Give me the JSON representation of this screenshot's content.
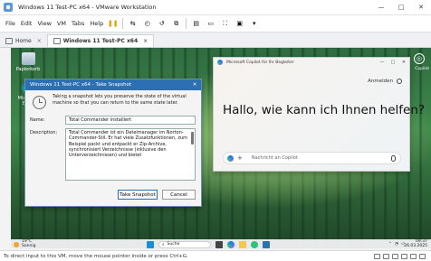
{
  "window": {
    "title": "Windows 11 Test-PC x64 - VMware Workstation",
    "controls": [
      "—",
      "□",
      "✕"
    ]
  },
  "menu": [
    "File",
    "Edit",
    "View",
    "VM",
    "Tabs",
    "Help"
  ],
  "tabs": [
    {
      "label": "Home"
    },
    {
      "label": "Windows 11 Test-PC x64"
    }
  ],
  "desktop": {
    "icons": [
      "Papierkorb",
      "Microsoft Edge"
    ],
    "copilot_label": "Copilot"
  },
  "snapshot_dialog": {
    "title": "Windows 11 Test-PC x64 - Take Snapshot",
    "info": "Taking a snapshot lets you preserve the state of the virtual machine so that you can return to the same state later.",
    "name_label": "Name:",
    "name_value": "Total Commander installiert",
    "description_label": "Description:",
    "description_value": "Total Commander ist ein Dateimanager im Norton-Commander-Stil. Er hat viele Zusatzfunktionen, zum Beispiel packt und entpackt er Zip-Archive, synchronisiert Verzeichnisse (inklusive den Unterverzeichnissen) und bietet",
    "take_button": "Take Snapshot",
    "cancel_button": "Cancel"
  },
  "copilot": {
    "window_title": "Microsoft Copilot für Ihr Begleiter",
    "controls": [
      "—",
      "□",
      "✕"
    ],
    "login": "Anmelden",
    "greeting": "Hallo, wie kann ich Ihnen helfen?",
    "input_placeholder": "Nachricht an Copilot"
  },
  "taskbar": {
    "temperature": "19°C",
    "weather": "Sonnig",
    "search": "Suche",
    "time": "09:37",
    "date": "26.03.2025"
  },
  "statusbar": {
    "text": "To direct input to this VM, move the mouse pointer inside or press Ctrl+G."
  }
}
